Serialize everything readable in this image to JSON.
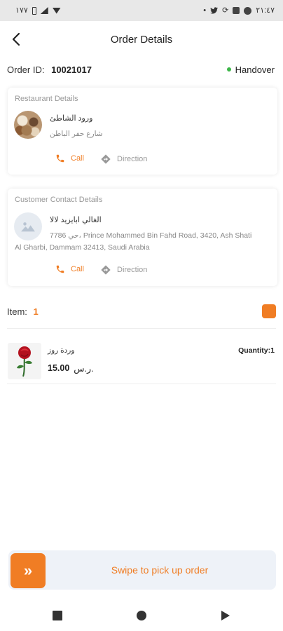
{
  "status_bar": {
    "time": "٢١:٤٧",
    "left_text": "١٧٧",
    "icons": [
      "battery-icon",
      "signal-icon",
      "wifi-icon",
      "dot-icon",
      "twitter-icon",
      "sync-icon",
      "app-icon",
      "camera-icon"
    ]
  },
  "header": {
    "title": "Order Details",
    "back_icon": "back-arrow-icon"
  },
  "order": {
    "id_label": "Order ID:",
    "id_value": "10021017",
    "status": "Handover",
    "status_color": "#3cb648"
  },
  "restaurant": {
    "section_title": "Restaurant Details",
    "name": "ورود الشاطئ",
    "address": "شارع حفر الباطن",
    "call_label": "Call",
    "direction_label": "Direction"
  },
  "customer": {
    "section_title": "Customer Contact Details",
    "name": "الغالي ابايزيد لالا",
    "address_line1": "7786 حي، Prince Mohammed Bin Fahd Road, 3420, Ash Shati",
    "address_line2": "Al Gharbi, Dammam 32413, Saudi Arabia",
    "call_label": "Call",
    "direction_label": "Direction"
  },
  "items": {
    "label": "Item:",
    "count": "1",
    "products": [
      {
        "name": "وردة روز",
        "currency": "ر.س.",
        "price": "15.00",
        "quantity_label": "Quantity:",
        "quantity": "1"
      }
    ]
  },
  "swipe": {
    "label": "Swipe to pick up order",
    "handle_symbol": "»"
  },
  "colors": {
    "accent": "#f07d24",
    "success": "#3cb648",
    "muted": "#999999",
    "swipe_bg": "#eef2f8"
  }
}
